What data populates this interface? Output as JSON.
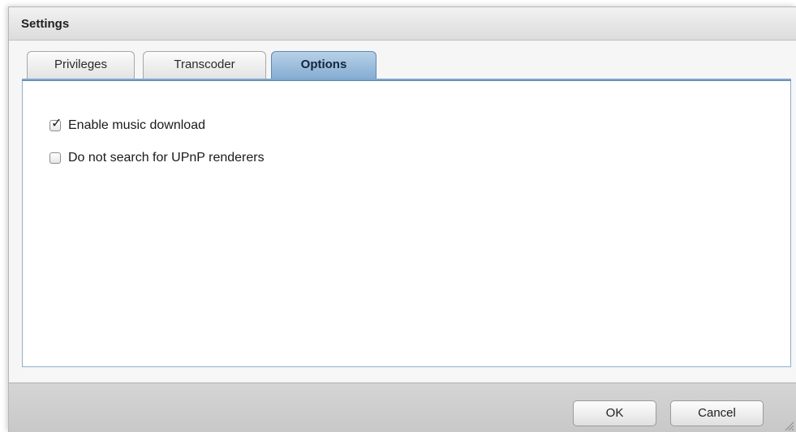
{
  "window": {
    "title": "Settings"
  },
  "tabs": [
    {
      "label": "Privileges",
      "active": false
    },
    {
      "label": "Transcoder",
      "active": false
    },
    {
      "label": "Options",
      "active": true
    }
  ],
  "options": [
    {
      "label": "Enable music download",
      "checked": true
    },
    {
      "label": "Do not search for UPnP renderers",
      "checked": false
    }
  ],
  "buttons": {
    "ok_label": "OK",
    "cancel_label": "Cancel"
  },
  "icons": {
    "checkmark": "checkmark-icon",
    "resize": "resize-grip-icon"
  },
  "colors": {
    "active_tab": "#86add2",
    "panel_border": "#8fb0cf",
    "background": "#f1f1f1"
  }
}
